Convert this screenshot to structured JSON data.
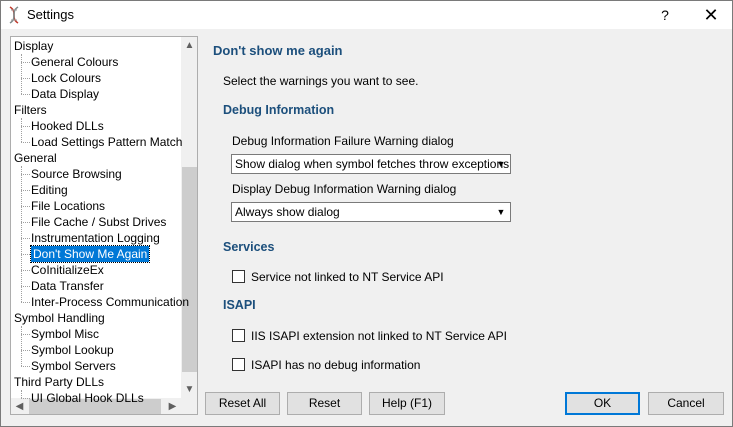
{
  "window": {
    "title": "Settings",
    "help_glyph": "?",
    "close_glyph": "✕"
  },
  "tree": {
    "items": [
      {
        "label": "Display",
        "level": 0
      },
      {
        "label": "General Colours",
        "level": 1
      },
      {
        "label": "Lock Colours",
        "level": 1
      },
      {
        "label": "Data Display",
        "level": 1
      },
      {
        "label": "Filters",
        "level": 0
      },
      {
        "label": "Hooked DLLs",
        "level": 1
      },
      {
        "label": "Load Settings Pattern Match",
        "level": 1
      },
      {
        "label": "General",
        "level": 0
      },
      {
        "label": "Source Browsing",
        "level": 1
      },
      {
        "label": "Editing",
        "level": 1
      },
      {
        "label": "File Locations",
        "level": 1
      },
      {
        "label": "File Cache / Subst Drives",
        "level": 1
      },
      {
        "label": "Instrumentation Logging",
        "level": 1
      },
      {
        "label": "Don't Show Me Again",
        "level": 1,
        "selected": true
      },
      {
        "label": "CoInitializeEx",
        "level": 1
      },
      {
        "label": "Data Transfer",
        "level": 1
      },
      {
        "label": "Inter-Process Communication",
        "level": 1
      },
      {
        "label": "Symbol Handling",
        "level": 0
      },
      {
        "label": "Symbol Misc",
        "level": 1
      },
      {
        "label": "Symbol Lookup",
        "level": 1
      },
      {
        "label": "Symbol Servers",
        "level": 1
      },
      {
        "label": "Third Party DLLs",
        "level": 0
      },
      {
        "label": "UI Global Hook DLLs",
        "level": 1
      }
    ]
  },
  "panel": {
    "heading": "Don't show me again",
    "intro": "Select the warnings you want to see.",
    "debug_section": "Debug Information",
    "failure_label": "Debug Information Failure Warning dialog",
    "failure_value": "Show dialog when symbol fetches throw exceptions",
    "display_label": "Display Debug Information Warning dialog",
    "display_value": "Always show dialog",
    "services_section": "Services",
    "service_checkbox": "Service not linked to NT Service API",
    "isapi_section": "ISAPI",
    "isapi_checkbox1": "IIS ISAPI extension not linked to NT Service API",
    "isapi_checkbox2": "ISAPI has no debug information"
  },
  "buttons": {
    "reset_all": "Reset All",
    "reset": "Reset",
    "help": "Help (F1)",
    "ok": "OK",
    "cancel": "Cancel"
  },
  "colors": {
    "heading": "#1c4f7c",
    "selection": "#0078d7"
  }
}
